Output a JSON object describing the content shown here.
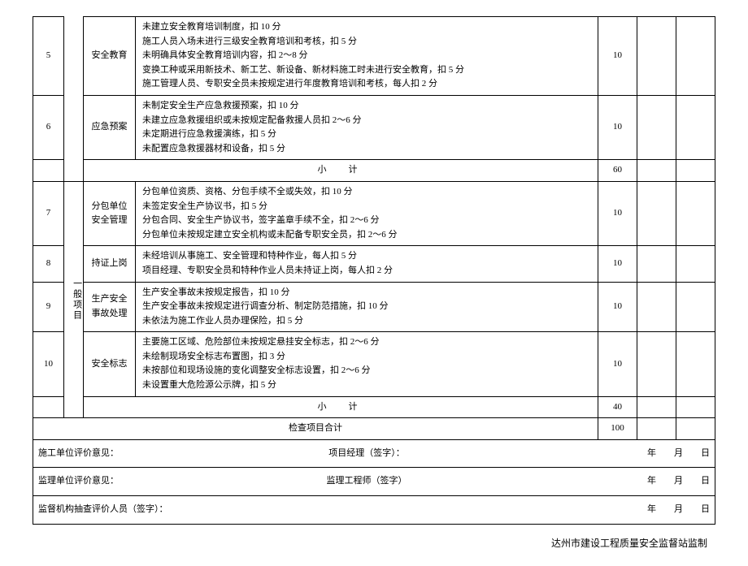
{
  "rows": [
    {
      "num": "5",
      "item": "安全教育",
      "desc": "未建立安全教育培训制度，扣 10 分\n施工人员入场未进行三级安全教育培训和考核，扣 5 分\n未明确具体安全教育培训内容，扣 2～8 分\n变换工种或采用新技术、新工艺、新设备、新材料施工时未进行安全教育，扣 5 分\n施工管理人员、专职安全员未按规定进行年度教育培训和考核，每人扣 2 分",
      "score": "10"
    },
    {
      "num": "6",
      "item": "应急预案",
      "desc": "未制定安全生产应急救援预案，扣 10 分\n未建立应急救援组织或未按规定配备救援人员扣 2～6 分\n未定期进行应急救援演练，扣 5 分\n未配置应急救援器材和设备，扣 5 分",
      "score": "10"
    }
  ],
  "subtotal1": {
    "label": "小　计",
    "score": "60"
  },
  "category2": "一般项目",
  "rows2": [
    {
      "num": "7",
      "item": "分包单位安全管理",
      "desc": "分包单位资质、资格、分包手续不全或失效，扣 10 分\n未签定安全生产协议书，扣 5 分\n分包合同、安全生产协议书，签字盖章手续不全，扣 2～6 分\n分包单位未按规定建立安全机构或未配备专职安全员，扣 2～6 分",
      "score": "10"
    },
    {
      "num": "8",
      "item": "持证上岗",
      "desc": "未经培训从事施工、安全管理和特种作业，每人扣 5 分\n项目经理、专职安全员和特种作业人员未持证上岗，每人扣 2 分",
      "score": "10"
    },
    {
      "num": "9",
      "item": "生产安全事故处理",
      "desc": "生产安全事故未按规定报告，扣 10 分\n生产安全事故未按规定进行调查分析、制定防范措施，扣 10 分\n未依法为施工作业人员办理保险，扣 5 分",
      "score": "10"
    },
    {
      "num": "10",
      "item": "安全标志",
      "desc": "主要施工区域、危险部位未按规定悬挂安全标志，扣 2～6 分\n未绘制现场安全标志布置图，扣 3 分\n未按部位和现场设施的变化调整安全标志设置，扣 2～6 分\n未设置重大危险源公示牌，扣 5 分",
      "score": "10"
    }
  ],
  "subtotal2": {
    "label": "小　计",
    "score": "40"
  },
  "total": {
    "label": "检查项目合计",
    "score": "100"
  },
  "sig": {
    "r1_left": "施工单位评价意见：",
    "r1_mid": "项目经理（签字）：",
    "r2_left": "监理单位评价意见：",
    "r2_mid": "监理工程师（签字）",
    "r3_left": "监督机构抽查评价人员（签字）：",
    "date": "年　　月　　日"
  },
  "footer": "达州市建设工程质量安全监督站监制"
}
